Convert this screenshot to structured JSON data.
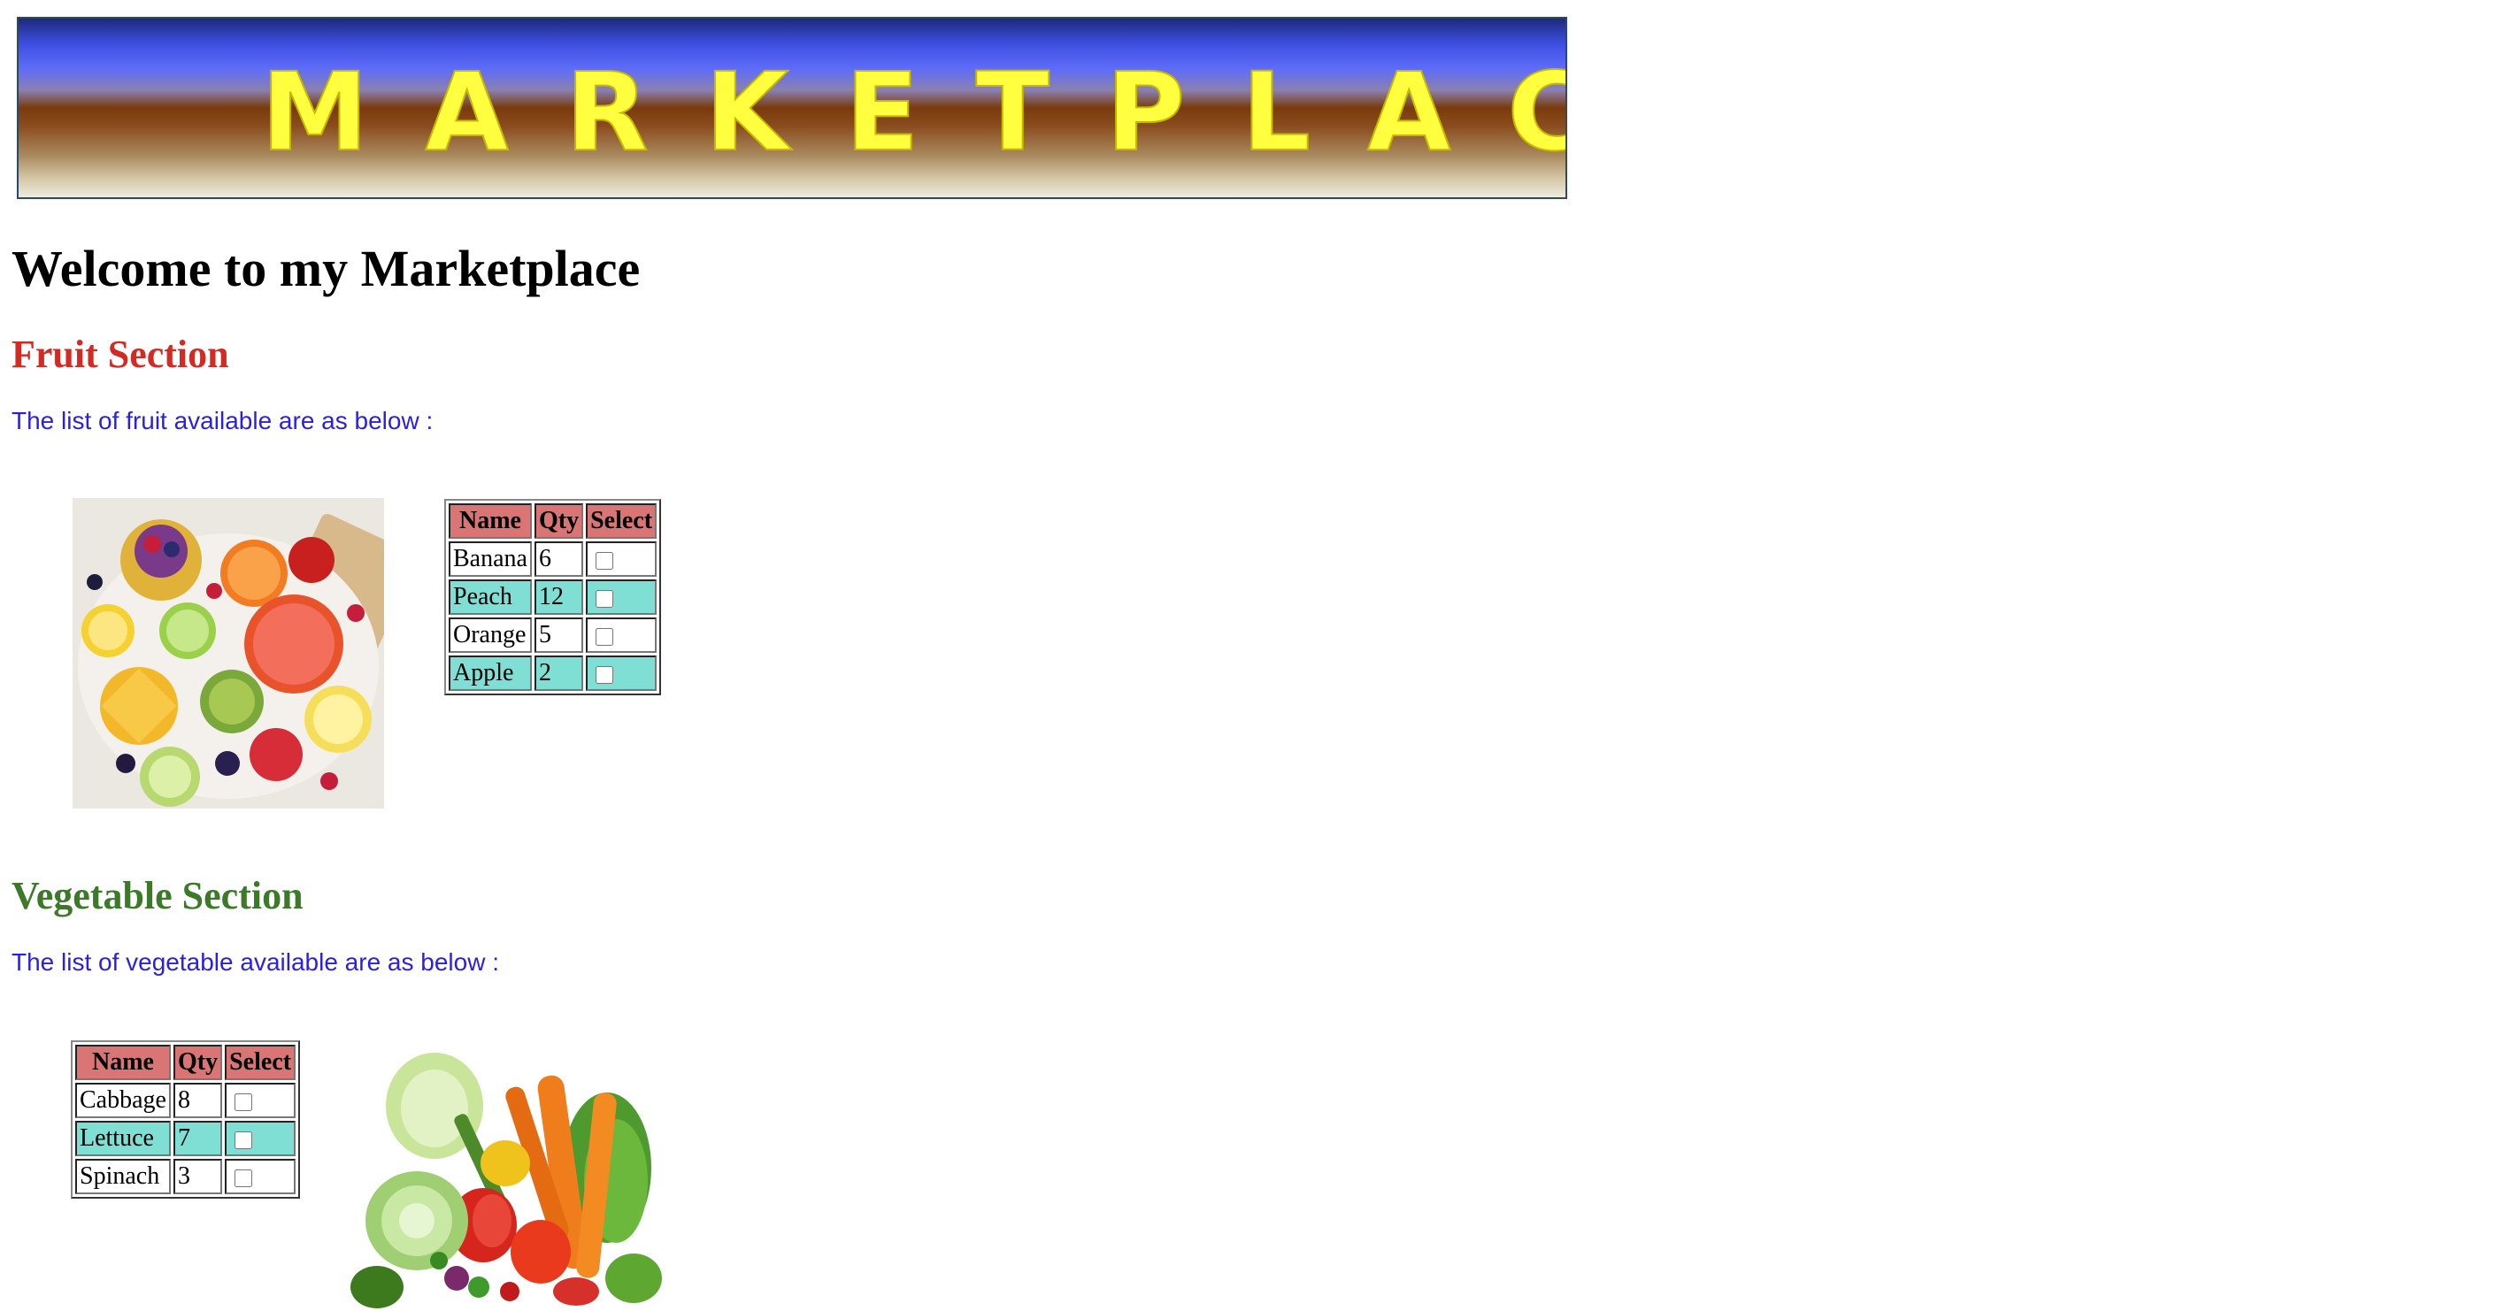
{
  "banner": {
    "text": "MARKETPLACE"
  },
  "page_title": "Welcome to my Marketplace",
  "fruit_section": {
    "title": "Fruit Section",
    "intro": "The list of fruit available are as below :",
    "table": {
      "headers": [
        "Name",
        "Qty",
        "Select"
      ],
      "rows": [
        {
          "name": "Banana",
          "qty": "6",
          "selected": false
        },
        {
          "name": "Peach",
          "qty": "12",
          "selected": false
        },
        {
          "name": "Orange",
          "qty": "5",
          "selected": false
        },
        {
          "name": "Apple",
          "qty": "2",
          "selected": false
        }
      ]
    }
  },
  "vegetable_section": {
    "title": "Vegetable Section",
    "intro": "The list of vegetable available are as below :",
    "table": {
      "headers": [
        "Name",
        "Qty",
        "Select"
      ],
      "rows": [
        {
          "name": "Cabbage",
          "qty": "8",
          "selected": false
        },
        {
          "name": "Lettuce",
          "qty": "7",
          "selected": false
        },
        {
          "name": "Spinach",
          "qty": "3",
          "selected": false
        }
      ]
    }
  },
  "colors": {
    "fruit_title": "#d32b24",
    "vegetable_title": "#3c7a2a",
    "intro_text": "#2a1fe8",
    "header_cell": "#d97575",
    "alt_row": "#7fdfd5",
    "banner_text": "#ffff40"
  }
}
